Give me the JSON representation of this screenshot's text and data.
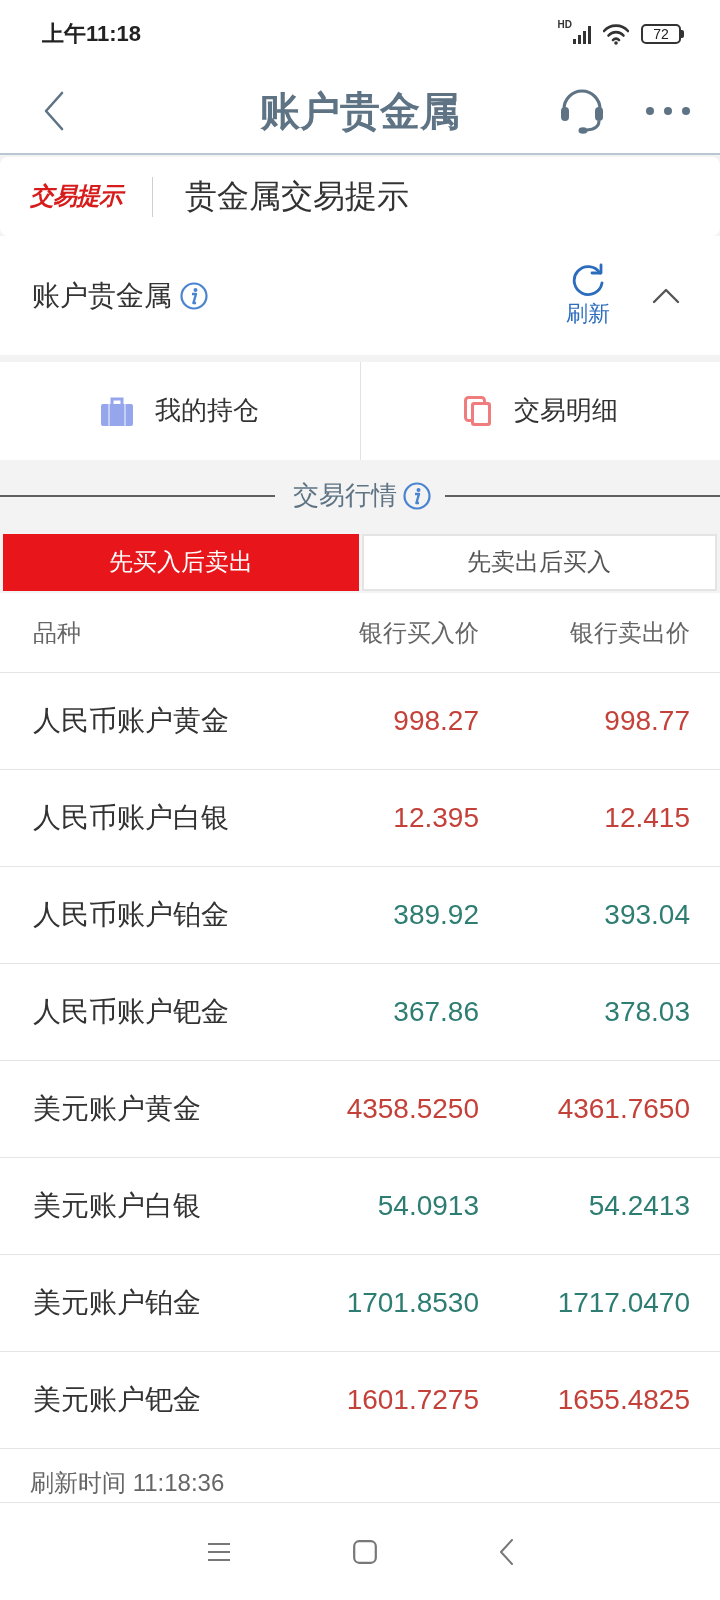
{
  "status_bar": {
    "time": "上午11:18",
    "network": "HD",
    "battery": "72"
  },
  "header": {
    "title": "账户贵金属"
  },
  "banner": {
    "logo": "交易提示",
    "title": "贵金属交易提示"
  },
  "account": {
    "title": "账户贵金属",
    "refresh_label": "刷新",
    "expanded": true
  },
  "quick_actions": [
    {
      "label": "我的持仓"
    },
    {
      "label": "交易明细"
    }
  ],
  "market": {
    "title": "交易行情",
    "tabs": [
      {
        "label": "先买入后卖出",
        "selected": true
      },
      {
        "label": "先卖出后买入",
        "selected": false
      }
    ],
    "columns": [
      "品种",
      "银行买入价",
      "银行卖出价"
    ],
    "rows": [
      {
        "name": "人民币账户黄金",
        "buy": "998.27",
        "sell": "998.77",
        "color": "#c4413a"
      },
      {
        "name": "人民币账户白银",
        "buy": "12.395",
        "sell": "12.415",
        "color": "#c4413a"
      },
      {
        "name": "人民币账户铂金",
        "buy": "389.92",
        "sell": "393.04",
        "color": "#2e7d72"
      },
      {
        "name": "人民币账户钯金",
        "buy": "367.86",
        "sell": "378.03",
        "color": "#2e7d72"
      },
      {
        "name": "美元账户黄金",
        "buy": "4358.5250",
        "sell": "4361.7650",
        "color": "#c4413a"
      },
      {
        "name": "美元账户白银",
        "buy": "54.0913",
        "sell": "54.2413",
        "color": "#2e7d72"
      },
      {
        "name": "美元账户铂金",
        "buy": "1701.8530",
        "sell": "1717.0470",
        "color": "#2e7d72"
      },
      {
        "name": "美元账户钯金",
        "buy": "1601.7275",
        "sell": "1655.4825",
        "color": "#c4413a"
      }
    ],
    "refresh_time": "刷新时间 11:18:36"
  }
}
